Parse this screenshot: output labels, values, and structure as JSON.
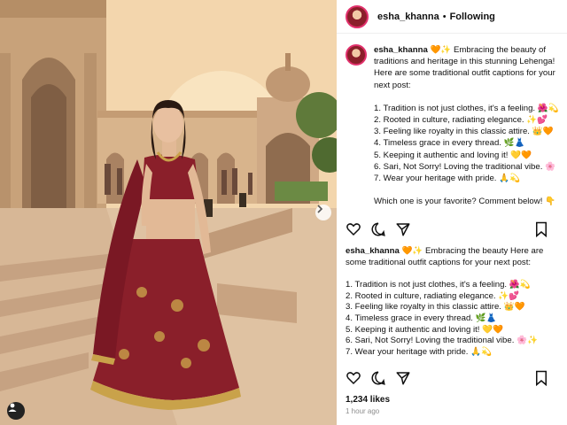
{
  "post": {
    "username": "esha_khanna",
    "separator": "•",
    "follow_status": "Following"
  },
  "caption": {
    "username": "esha_khanna",
    "intro": "🧡✨ Embracing the beauty of traditions and heritage in this stunning Lehenga! Here are some traditional outfit captions for your next post:",
    "items": [
      "1. Tradition is not just clothes, it's a feeling. 🌺💫",
      "2. Rooted in culture, radiating elegance. ✨💕",
      "3. Feeling like royalty in this classic attire. 👑🧡",
      "4. Timeless grace in every thread. 🌿👗",
      "5. Keeping it authentic and loving it! 💛🧡",
      "6. Sari, Not Sorry! Loving the traditional vibe. 🌸",
      "7. Wear your heritage with pride. 🙏💫"
    ],
    "question": "Which one is your favorite? Comment below! 👇"
  },
  "caption2": {
    "username": "esha_khanna",
    "intro": "🧡✨ Embracing the beauty Here are some traditional outfit captions for your next post:",
    "items": [
      "1. Tradition is not just clothes, it's a feeling. 🌺💫",
      "2. Rooted in culture, radiating elegance. ✨💕",
      "3. Feeling like royalty in this classic attire. 👑🧡",
      "4. Timeless grace in every thread. 🌿👗",
      "5. Keeping it authentic and loving it! 💛🧡",
      "6. Sari, Not Sorry! Loving the traditional vibe. 🌸✨",
      "7. Wear your heritage with pride. 🙏💫"
    ]
  },
  "stats": {
    "likes": "1,234 likes",
    "time": "1 hour ago"
  },
  "icons": {
    "like": "heart-icon",
    "comment": "comment-icon",
    "share": "send-icon",
    "save": "bookmark-icon",
    "next": "chevron-right-icon",
    "tags": "user-tag-icon"
  },
  "colors": {
    "story_ring": "#e1306c",
    "lehenga": "#8a1f2a",
    "gold": "#c9a24a"
  }
}
